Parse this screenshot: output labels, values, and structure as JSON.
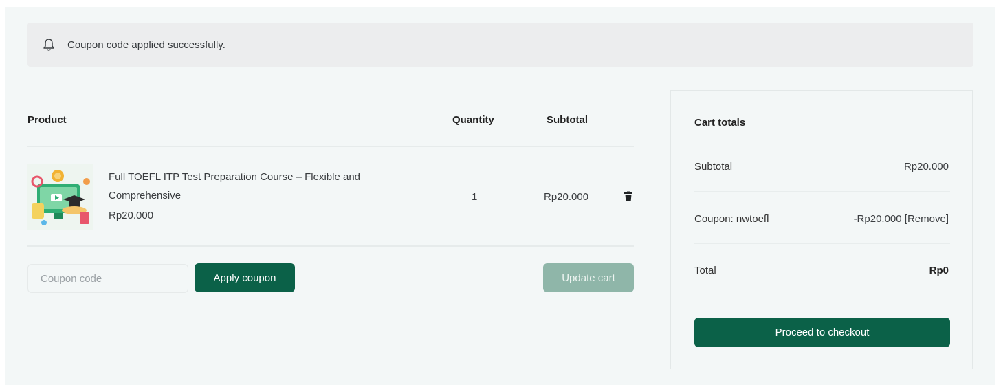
{
  "notice": {
    "icon": "bell-icon",
    "message": "Coupon code applied successfully."
  },
  "cart": {
    "columns": {
      "product": "Product",
      "quantity": "Quantity",
      "subtotal": "Subtotal"
    },
    "items": [
      {
        "name": "Full TOEFL ITP Test Preparation Course – Flexible and Comprehensive",
        "price": "Rp20.000",
        "quantity": "1",
        "subtotal": "Rp20.000",
        "remove_icon": "trash-icon"
      }
    ],
    "coupon": {
      "placeholder": "Coupon code",
      "apply_label": "Apply coupon"
    },
    "update_label": "Update cart"
  },
  "totals": {
    "title": "Cart totals",
    "subtotal_label": "Subtotal",
    "subtotal_value": "Rp20.000",
    "coupon_label": "Coupon: nwtoefl",
    "coupon_value": "-Rp20.000",
    "coupon_remove": "[Remove]",
    "total_label": "Total",
    "total_value": "Rp0",
    "checkout_label": "Proceed to checkout"
  },
  "colors": {
    "brand": "#0b6148",
    "brand_disabled": "#8fb6a9",
    "background": "#f3f7f7",
    "notice_bg": "#ecedee"
  }
}
